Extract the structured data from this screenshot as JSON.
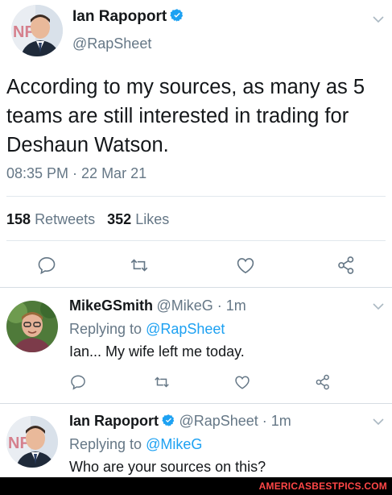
{
  "main_tweet": {
    "display_name": "Ian Rapoport",
    "handle": "@RapSheet",
    "text": "According to my sources, as many as 5 teams are still interested in trading for Deshaun Watson.",
    "timestamp": "08:35 PM · 22 Mar 21",
    "retweets_count": "158",
    "retweets_label": "Retweets",
    "likes_count": "352",
    "likes_label": "Likes"
  },
  "replies": [
    {
      "display_name": "MikeGSmith",
      "meta": "@MikeG · 1m",
      "replying_prefix": "Replying to",
      "replying_to": "@RapSheet",
      "text": "Ian... My wife left me today."
    },
    {
      "display_name": "Ian Rapoport",
      "meta": "@RapSheet · 1m",
      "replying_prefix": "Replying to",
      "replying_to": "@MikeG",
      "text": "Who are your sources on this?"
    }
  ],
  "watermark": "AMERICASBESTPICS.COM",
  "colors": {
    "accent": "#1da1f2",
    "text": "#14171a",
    "muted": "#657786",
    "divider": "#e1e8ed",
    "watermark": "#ff4747"
  },
  "icons": [
    "reply-icon",
    "retweet-icon",
    "like-icon",
    "share-icon",
    "verified-badge-icon",
    "chevron-down-icon"
  ]
}
